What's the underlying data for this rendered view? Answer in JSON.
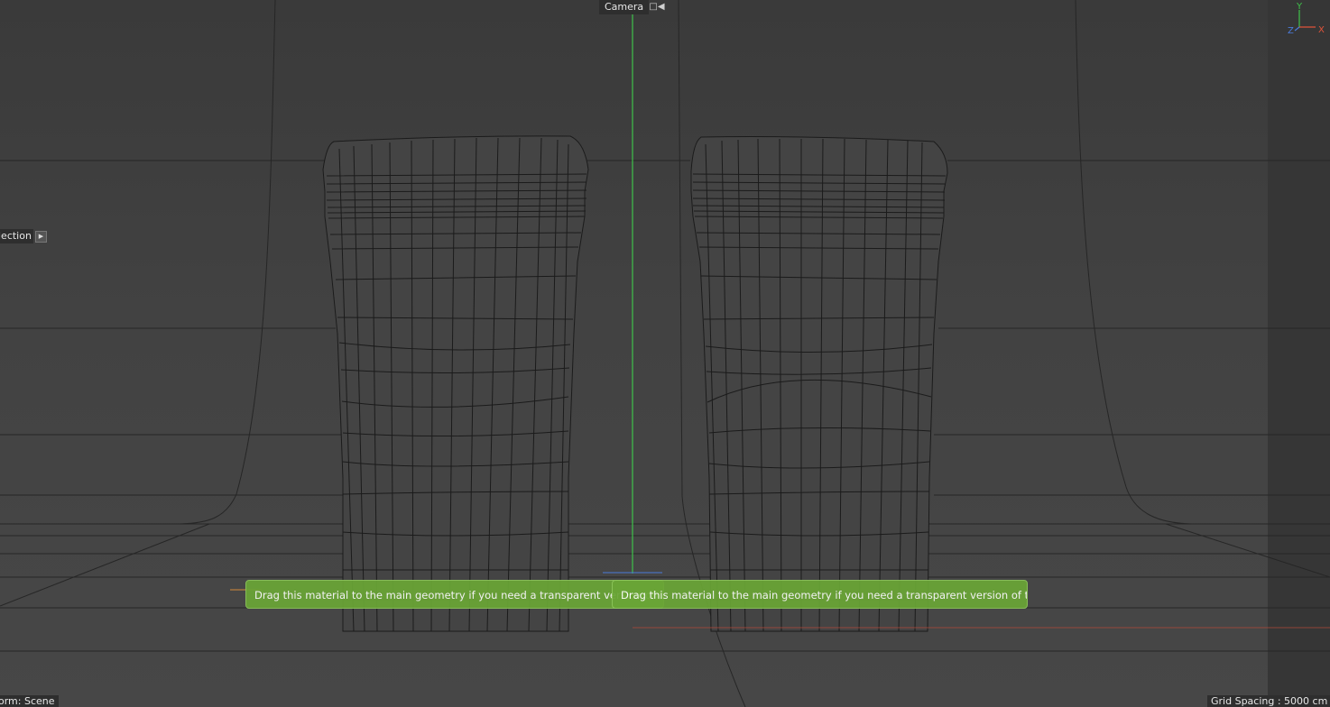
{
  "viewport": {
    "camera_label": "Camera",
    "camera_icon": "camera-icon",
    "selection_label": "lection",
    "selection_arrow_icon": "triangle-right-icon",
    "axis_labels": {
      "y": "Y",
      "z": "Z",
      "x": "X"
    },
    "colors": {
      "axis_y": "#3fc24a",
      "axis_x": "#e0533a",
      "axis_z": "#4a7ad9",
      "tooltip_bg": "#6aa536"
    }
  },
  "tooltips": [
    {
      "text": "Drag this material to the main geometry if you need a transparent version of the bag"
    },
    {
      "text": "Drag this material to the main geometry if you need a transparent version of the bag"
    }
  ],
  "status": {
    "left": "orm: Scene",
    "right": "Grid Spacing : 5000 cm"
  }
}
